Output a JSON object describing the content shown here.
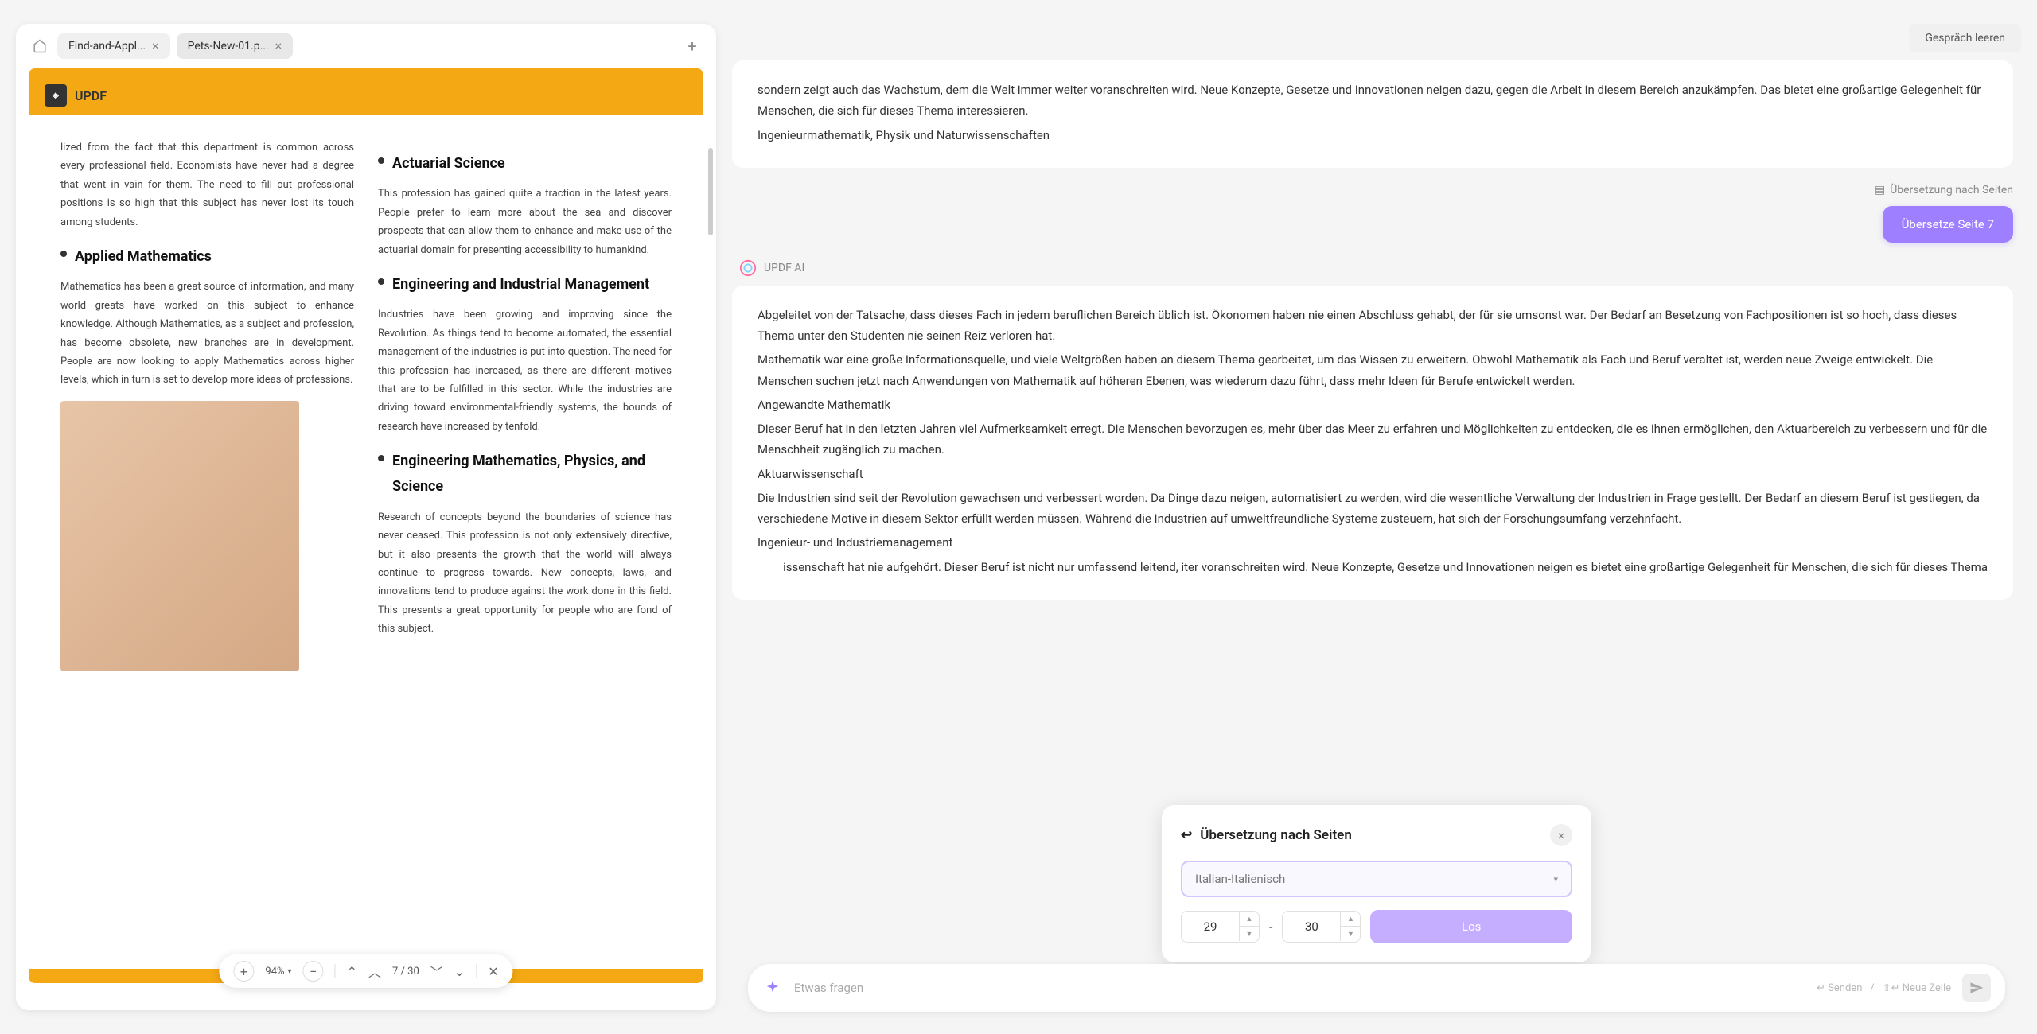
{
  "tabs": {
    "tab1": "Find-and-Appl...",
    "tab2": "Pets-New-01.p..."
  },
  "updf_brand": "UPDF",
  "doc": {
    "col1_intro": "lized from the fact that this department is common across every professional field. Economists have never had a degree that went in vain for them. The need to fill out professional positions is so high that this subject has never lost its touch among students.",
    "h1": "Applied Mathematics",
    "p1": "Mathematics has been a great source of information, and many world greats have worked on this subject to enhance knowledge. Although Mathematics, as a subject and profession, has become obsolete, new branches are in development. People are now looking to apply Mathematics across higher levels, which in turn is set to develop more ideas of professions.",
    "h2": "Actuarial Science",
    "p2": "This profession has gained quite a traction in the latest years. People prefer to learn more about the sea and discover prospects that can allow them to enhance and make use of the actuarial domain for presenting accessibility to humankind.",
    "h3": "Engineering and Industrial Management",
    "p3": "Industries have been growing and improving since the Revolution. As things tend to become automated, the essential management of the industries is put into question. The need for this profession has increased, as there are different motives that are to be fulfilled in this sector. While the industries are driving toward environmental-friendly systems, the bounds of research have increased by tenfold.",
    "h4": "Engineering Mathematics, Physics, and Science",
    "p4": "Research of concepts beyond the boundaries of science has never ceased. This profession is not only extensively directive, but it also presents the growth that the world will always continue to progress towards. New concepts, laws, and innovations tend to produce against the work done in this field. This presents a great opportunity for people who are fond of this subject."
  },
  "toolbar": {
    "zoom": "94%",
    "page_current": "7",
    "page_total": "30"
  },
  "right": {
    "clear": "Gespräch leeren",
    "msg1_a": "sondern zeigt auch das Wachstum, dem die Welt immer weiter voranschreiten wird. Neue Konzepte, Gesetze und Innovationen neigen dazu, gegen die Arbeit in diesem Bereich anzukämpfen. Das bietet eine großartige Gelegenheit für Menschen, die sich für dieses Thema interessieren.",
    "msg1_b": "Ingenieurmathematik, Physik und Naturwissenschaften",
    "meta": "Übersetzung nach Seiten",
    "translate_btn": "Übersetze Seite 7",
    "ai_name": "UPDF AI",
    "msg2_a": "Abgeleitet von der Tatsache, dass dieses Fach in jedem beruflichen Bereich üblich ist. Ökonomen haben nie einen Abschluss gehabt, der für sie umsonst war. Der Bedarf an Besetzung von Fachpositionen ist so hoch, dass dieses Thema unter den Studenten nie seinen Reiz verloren hat.",
    "msg2_b": "Mathematik war eine große Informationsquelle, und viele Weltgrößen haben an diesem Thema gearbeitet, um das Wissen zu erweitern. Obwohl Mathematik als Fach und Beruf veraltet ist, werden neue Zweige entwickelt. Die Menschen suchen jetzt nach Anwendungen von Mathematik auf höheren Ebenen, was wiederum dazu führt, dass mehr Ideen für Berufe entwickelt werden.",
    "msg2_c": "Angewandte Mathematik",
    "msg2_d": "Dieser Beruf hat in den letzten Jahren viel Aufmerksamkeit erregt. Die Menschen bevorzugen es, mehr über das Meer zu erfahren und Möglichkeiten zu entdecken, die es ihnen ermöglichen, den Aktuarbereich zu verbessern und für die Menschheit zugänglich zu machen.",
    "msg2_e": "Aktuarwissenschaft",
    "msg2_f": "Die Industrien sind seit der Revolution gewachsen und verbessert worden. Da Dinge dazu neigen, automatisiert zu werden, wird die wesentliche Verwaltung der Industrien in Frage gestellt. Der Bedarf an diesem Beruf ist gestiegen, da verschiedene Motive in diesem Sektor erfüllt werden müssen. Während die Industrien auf umweltfreundliche Systeme zusteuern, hat sich der Forschungsumfang verzehnfacht.",
    "msg2_g": "Ingenieur- und Industriemanagement",
    "msg2_h": "issenschaft hat nie aufgehört. Dieser Beruf ist nicht nur umfassend leitend, iter voranschreiten wird. Neue Konzepte, Gesetze und Innovationen neigen es bietet eine großartige Gelegenheit für Menschen, die sich für dieses Thema"
  },
  "popup": {
    "title": "Übersetzung nach Seiten",
    "language": "Italian-Italienisch",
    "from": "29",
    "to": "30",
    "go": "Los"
  },
  "input": {
    "placeholder": "Etwas fragen",
    "hint_send": "Senden",
    "hint_newline": "Neue Zeile"
  }
}
